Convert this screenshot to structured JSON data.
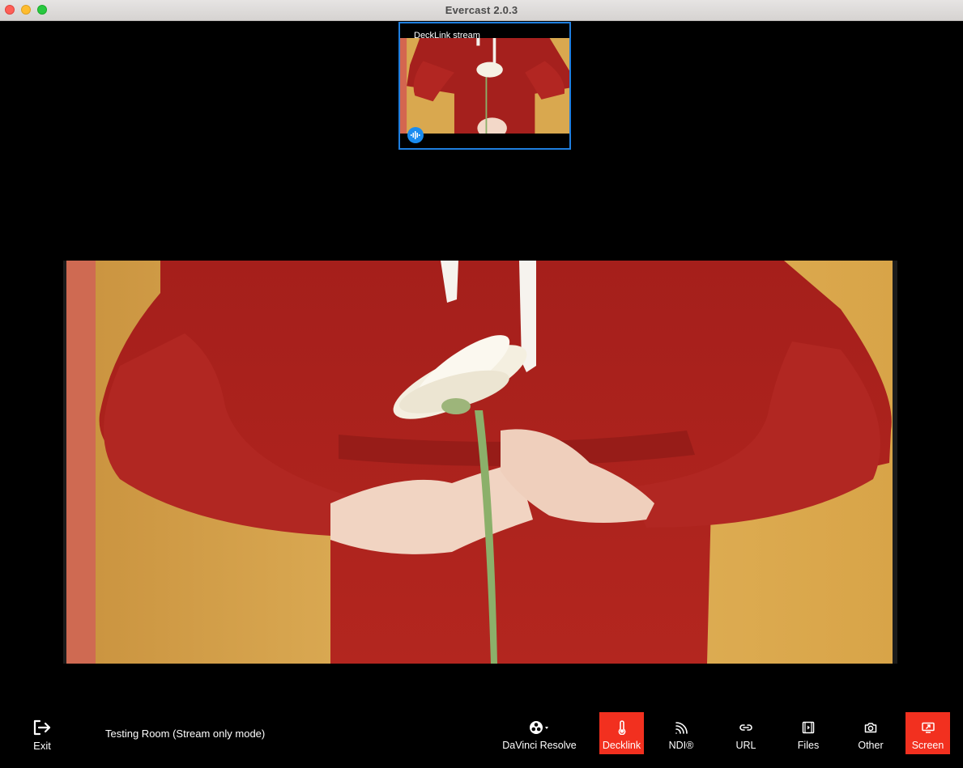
{
  "window": {
    "title": "Evercast 2.0.3"
  },
  "thumbnail": {
    "label": "DeckLink stream"
  },
  "colors": {
    "accent_active": "#f2301f",
    "thumb_border": "#1f7fe0",
    "audio_badge": "#1a8cf0"
  },
  "toolbar": {
    "exit_label": "Exit",
    "room_name": "Testing Room (Stream only mode)",
    "sources": [
      {
        "id": "davinci",
        "label": "DaVinci Resolve",
        "icon": "davinci-resolve-icon",
        "active": false
      },
      {
        "id": "decklink",
        "label": "Decklink",
        "icon": "thermometer-icon",
        "active": true
      },
      {
        "id": "ndi",
        "label": "NDI®",
        "icon": "ndi-signal-icon",
        "active": false
      },
      {
        "id": "url",
        "label": "URL",
        "icon": "link-icon",
        "active": false
      },
      {
        "id": "files",
        "label": "Files",
        "icon": "film-icon",
        "active": false
      },
      {
        "id": "other",
        "label": "Other",
        "icon": "camera-icon",
        "active": false
      },
      {
        "id": "screen",
        "label": "Screen",
        "icon": "screen-share-icon",
        "active": true
      }
    ]
  }
}
